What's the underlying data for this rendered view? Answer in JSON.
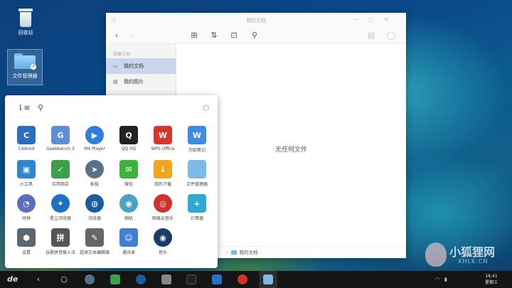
{
  "desktop": {
    "icons": [
      {
        "label": "回收站"
      },
      {
        "label": "文件管理器"
      }
    ]
  },
  "file_manager": {
    "title": "我的文档",
    "sidebar": {
      "section": "收藏文档",
      "items": [
        {
          "label": "我的文档",
          "icon": "folder-icon",
          "active": true
        },
        {
          "label": "我的图片",
          "icon": "image-icon",
          "active": false
        }
      ]
    },
    "empty_message": "无任何文件",
    "breadcrumb": "我的文档"
  },
  "start_menu": {
    "apps": [
      {
        "label": "C4droid",
        "icon": "c4droid-icon",
        "color": "#2a6fbf",
        "glyph": "C"
      },
      {
        "label": "Geekbench 3",
        "icon": "geekbench-icon",
        "color": "#5c8fd6",
        "glyph": "G"
      },
      {
        "label": "MX Player",
        "icon": "play-icon",
        "color": "#2f7de1",
        "glyph": "▶"
      },
      {
        "label": "QQ HD",
        "icon": "penguin-icon",
        "color": "#222222",
        "glyph": "Q"
      },
      {
        "label": "WPS Office",
        "icon": "wps-icon",
        "color": "#d9362b",
        "glyph": "W"
      },
      {
        "label": "为知笔记",
        "icon": "wiz-note-icon",
        "color": "#3d8be6",
        "glyph": "W"
      },
      {
        "label": "小工具",
        "icon": "tools-icon",
        "color": "#2d86d0",
        "glyph": "▣"
      },
      {
        "label": "应用商店",
        "icon": "store-icon",
        "color": "#3aa04a",
        "glyph": "✓"
      },
      {
        "label": "影梭",
        "icon": "shadowsocks-icon",
        "color": "#5a6f8c",
        "glyph": "➤"
      },
      {
        "label": "微信",
        "icon": "wechat-icon",
        "color": "#3cb43c",
        "glyph": "✉"
      },
      {
        "label": "我的下载",
        "icon": "download-icon",
        "color": "#f2a51a",
        "glyph": "↓"
      },
      {
        "label": "文件管理器",
        "icon": "folder-icon",
        "color": "#7cbaea",
        "glyph": ""
      },
      {
        "label": "时钟",
        "icon": "clock-icon",
        "color": "#5b6fb8",
        "glyph": "◔"
      },
      {
        "label": "星尘浏览器",
        "icon": "stardust-browser-icon",
        "color": "#1f6fc2",
        "glyph": "✦"
      },
      {
        "label": "浏览器",
        "icon": "globe-icon",
        "color": "#1b5b9e",
        "glyph": "◍"
      },
      {
        "label": "相机",
        "icon": "camera-icon",
        "color": "#4aa3c2",
        "glyph": "◉"
      },
      {
        "label": "网易云音乐",
        "icon": "netease-music-icon",
        "color": "#d3322b",
        "glyph": "◎"
      },
      {
        "label": "计算器",
        "icon": "calculator-icon",
        "color": "#2fa8d6",
        "glyph": "+"
      },
      {
        "label": "设置",
        "icon": "gear-icon",
        "color": "#5b6673",
        "glyph": "⬢"
      },
      {
        "label": "谷歌拼音输入法",
        "icon": "pinyin-icon",
        "color": "#555555",
        "glyph": "拼"
      },
      {
        "label": "超卓文本编辑器",
        "icon": "text-editor-icon",
        "color": "#666666",
        "glyph": "✎"
      },
      {
        "label": "通讯录",
        "icon": "contacts-icon",
        "color": "#3f7fd6",
        "glyph": "☺"
      },
      {
        "label": "音乐",
        "icon": "music-icon",
        "color": "#1c3b6b",
        "glyph": "◉"
      }
    ]
  },
  "taskbar": {
    "time": "16:41",
    "day": "星期三"
  },
  "watermark": {
    "text": "小狐狸网",
    "sub": "XHLK.CN"
  }
}
